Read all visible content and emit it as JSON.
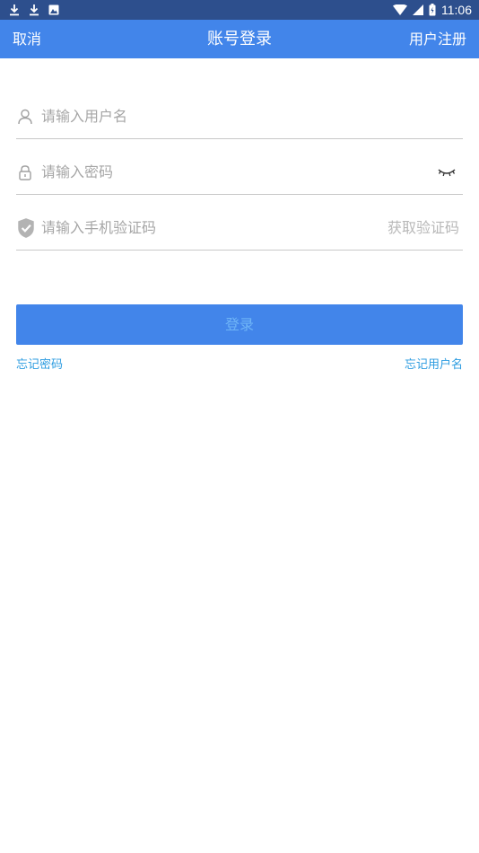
{
  "status_bar": {
    "time": "11:06",
    "icons": [
      "download-icon",
      "download-icon",
      "photo-icon",
      "wifi-icon",
      "signal-icon",
      "battery-icon"
    ]
  },
  "header": {
    "cancel": "取消",
    "title": "账号登录",
    "register": "用户注册"
  },
  "form": {
    "username_placeholder": "请输入用户名",
    "password_placeholder": "请输入密码",
    "sms_placeholder": "请输入手机验证码",
    "get_code": "获取验证码"
  },
  "login_button": "登录",
  "links": {
    "forgot_password": "忘记密码",
    "forgot_username": "忘记用户名"
  },
  "colors": {
    "status_bar": "#2d4f8d",
    "header": "#4285ea",
    "button": "#4285ea",
    "link": "#2d9ce0"
  }
}
